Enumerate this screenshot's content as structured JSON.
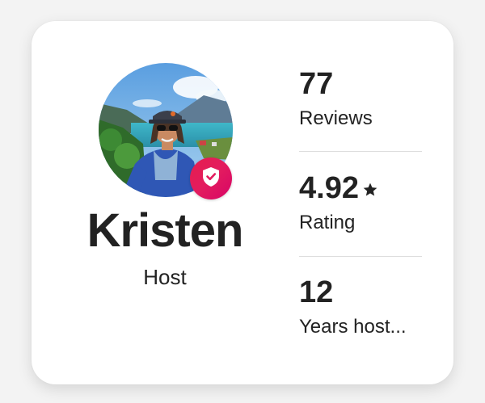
{
  "host": {
    "name": "Kristen",
    "role": "Host",
    "avatar_icon": "profile-photo",
    "badge_icon": "verified-shield-icon",
    "badge_color": "#e31c5f"
  },
  "stats": [
    {
      "value": "77",
      "label": "Reviews"
    },
    {
      "value": "4.92",
      "label": "Rating",
      "icon": "star-icon"
    },
    {
      "value": "12",
      "label": "Years host..."
    }
  ]
}
